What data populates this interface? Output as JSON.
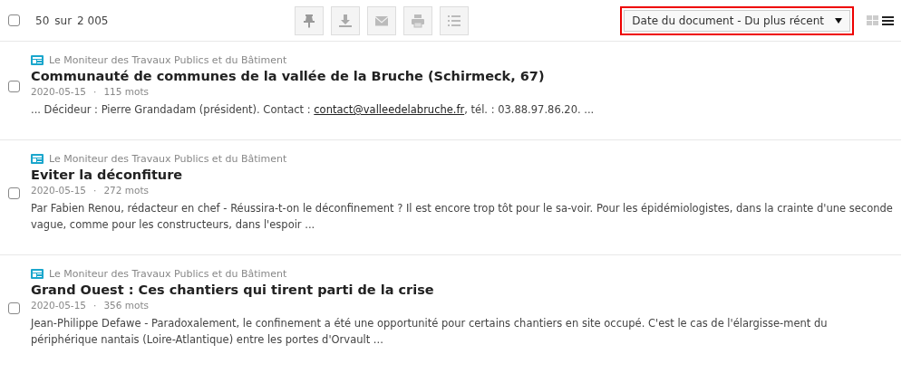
{
  "toolbar": {
    "select_all": {
      "checked": false
    },
    "count": "50",
    "count_sep": "sur",
    "total": "2 005",
    "actions": [
      {
        "kind": "pin"
      },
      {
        "kind": "download"
      },
      {
        "kind": "mail"
      },
      {
        "kind": "print"
      },
      {
        "kind": "list"
      }
    ],
    "sort": {
      "value": "Date du document - Du plus récent",
      "highlighted": true
    },
    "views": [
      {
        "kind": "grid",
        "selected": false
      },
      {
        "kind": "list",
        "selected": true
      }
    ]
  },
  "results": [
    {
      "source": "Le Moniteur des Travaux Publics et du Bâtiment",
      "title": "Communauté de communes de la vallée de la Bruche (Schirmeck, 67)",
      "date": "2020-05-15",
      "meta_sep": "·",
      "words": "115 mots",
      "checked": false,
      "snippet": "... Décideur : Pierre Grandadam (président). Contact : ",
      "link": "contact@valleedelabruche.fr",
      "snippet_after": ", tél. : 03.88.97.86.20. ..."
    },
    {
      "source": "Le Moniteur des Travaux Publics et du Bâtiment",
      "title": "Eviter la déconfiture",
      "date": "2020-05-15",
      "meta_sep": "·",
      "words": "272 mots",
      "checked": false,
      "snippet": "Par Fabien Renou, rédacteur en chef - Réussira-t-on le déconfinement ? Il est encore trop tôt pour le sa-voir. Pour les épidémiologistes, dans la crainte d'une seconde vague, comme pour les constructeurs, dans l'espoir ..."
    },
    {
      "source": "Le Moniteur des Travaux Publics et du Bâtiment",
      "title": "Grand Ouest : Ces chantiers qui tirent parti de la crise",
      "date": "2020-05-15",
      "meta_sep": "·",
      "words": "356 mots",
      "checked": false,
      "snippet": "Jean-Philippe Defawe - Paradoxalement, le confinement a été une opportunité pour certains chantiers en site occupé. C'est le cas de l'élargisse-ment du périphérique nantais (Loire-Atlantique) entre les portes d'Orvault ..."
    }
  ]
}
